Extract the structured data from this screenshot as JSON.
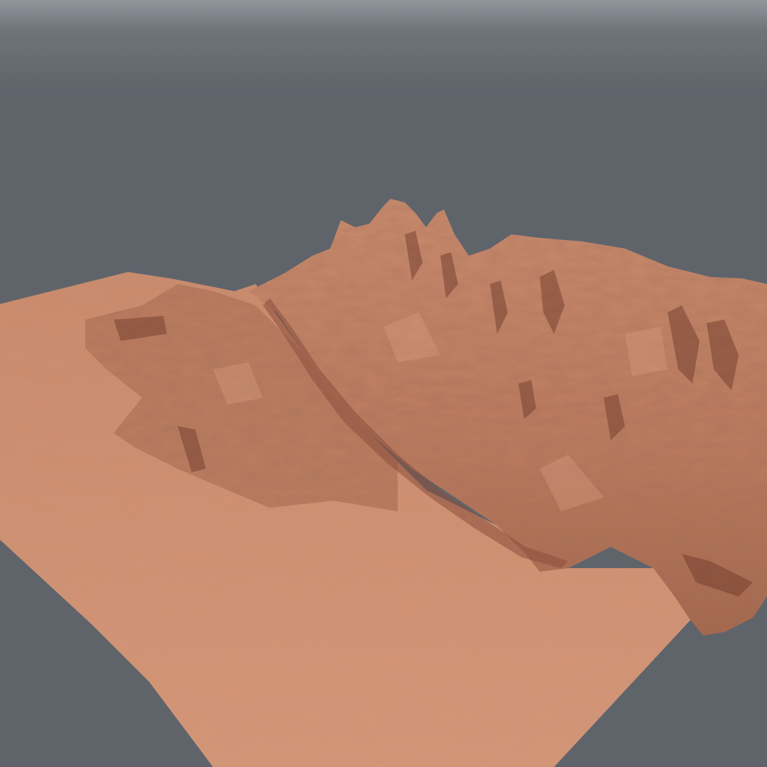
{
  "scene": {
    "subject": "terrain-render",
    "colors": {
      "background": "#5f646b",
      "horizon_haze": "#8e959b",
      "terrain_base": "#c98a6c",
      "terrain_light": "#d9a083",
      "terrain_shadow": "#8a4f3c",
      "terrain_deep_shadow": "#5c2e22"
    }
  }
}
